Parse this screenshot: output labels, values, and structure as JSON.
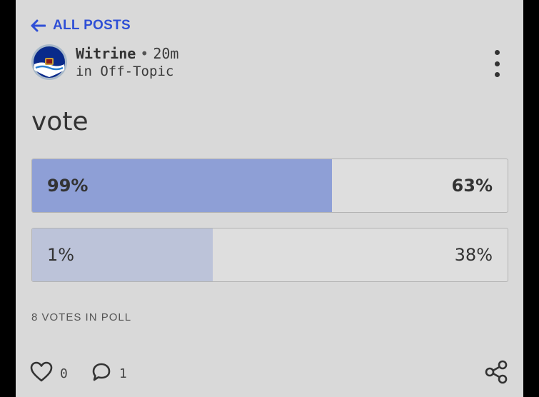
{
  "header": {
    "back_label": "ALL POSTS"
  },
  "post": {
    "author": "Witrine",
    "time": "20m",
    "community": "in Off-Topic",
    "title": "vote"
  },
  "poll": {
    "options": [
      {
        "left_label": "99%",
        "right_label": "63%",
        "fill_fraction": 0.63,
        "fill_color": "#8e9fd6"
      },
      {
        "left_label": "1%",
        "right_label": "38%",
        "fill_fraction": 0.38,
        "fill_color": "#bcc3d9"
      }
    ],
    "votes_label": "8 VOTES IN POLL"
  },
  "actions": {
    "likes": "0",
    "comments": "1"
  },
  "icons": [
    "arrow-left-icon",
    "more-vertical-icon",
    "heart-icon",
    "comment-icon",
    "share-icon"
  ]
}
